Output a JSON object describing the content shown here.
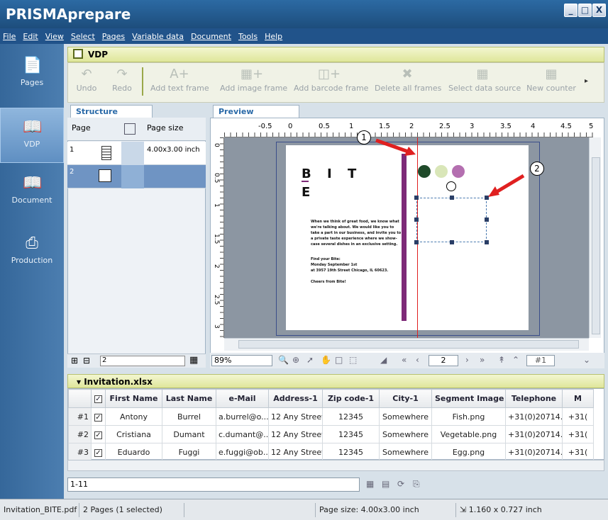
{
  "app": {
    "title": "PRISMAprepare"
  },
  "window_buttons": [
    "_",
    "□",
    "X"
  ],
  "menu": [
    "File",
    "Edit",
    "View",
    "Select",
    "Pages",
    "Variable data",
    "Document",
    "Tools",
    "Help"
  ],
  "nav": {
    "items": [
      {
        "label": "Pages",
        "icon": "pages-icon"
      },
      {
        "label": "VDP",
        "icon": "vdp-icon"
      },
      {
        "label": "Document",
        "icon": "document-icon"
      },
      {
        "label": "Production",
        "icon": "printer-icon"
      }
    ]
  },
  "vdp": {
    "title": "VDP"
  },
  "toolbar": {
    "undo": "Undo",
    "redo": "Redo",
    "add_text": "Add text frame",
    "add_image": "Add image frame",
    "add_barcode": "Add barcode frame",
    "delete_all": "Delete all frames",
    "select_source": "Select data source",
    "new_counter": "New counter"
  },
  "structure": {
    "tab": "Structure",
    "col_page": "Page",
    "col_size": "Page size",
    "rows": [
      {
        "page": "1",
        "size": "4.00x3.00 inch"
      },
      {
        "page": "2",
        "size": ""
      }
    ],
    "page_input": "2"
  },
  "preview": {
    "tab": "Preview",
    "ruler_labels": [
      "-0.5",
      "0",
      "0.5",
      "1",
      "1.5",
      "2",
      "2.5",
      "3",
      "3.5",
      "4",
      "4.5",
      "5"
    ],
    "ruler_left": [
      "0",
      "0.5",
      "1",
      "1.5",
      "2",
      "2.5",
      "3"
    ],
    "callouts": [
      "1",
      "2"
    ],
    "zoom": "89%",
    "page_number": "2",
    "record_number": "#1"
  },
  "document": {
    "logo_line1": "B I T",
    "logo_line2": "E",
    "body": "When we think of great food, we know what we're talking about. We would like you to take a part in our business, and invite you to a private taste experience where we show-case several dishes in an exclusive setting.",
    "find": "Find your Bite:",
    "date": "Monday September 1st",
    "address": "at 3957 19th Street Chicago, IL 60623.",
    "cheers": "Cheers from Bite!"
  },
  "data": {
    "file": "Invitation.xlsx",
    "columns": [
      "First Name",
      "Last Name",
      "e-Mail",
      "Address-1",
      "Zip code-1",
      "City-1",
      "Segment Image",
      "Telephone",
      "M"
    ],
    "rows": [
      {
        "no": "#1",
        "cells": [
          "Antony",
          "Burrel",
          "a.burrel@o...",
          "12 Any Street",
          "12345",
          "Somewhere",
          "Fish.png",
          "+31(0)20714...",
          "+31("
        ]
      },
      {
        "no": "#2",
        "cells": [
          "Cristiana",
          "Dumant",
          "c.dumant@...",
          "12 Any Street",
          "12345",
          "Somewhere",
          "Vegetable.png",
          "+31(0)20714...",
          "+31("
        ]
      },
      {
        "no": "#3",
        "cells": [
          "Eduardo",
          "Fuggi",
          "e.fuggi@ob...",
          "12 Any Street",
          "12345",
          "Somewhere",
          "Egg.png",
          "+31(0)20714...",
          "+31("
        ]
      }
    ],
    "filter": "1-11"
  },
  "status": {
    "file": "Invitation_BITE.pdf",
    "pages": "2 Pages (1 selected)",
    "page_size": "Page size: 4.00x3.00 inch",
    "frame_size": "1.160 x 0.727 inch"
  }
}
